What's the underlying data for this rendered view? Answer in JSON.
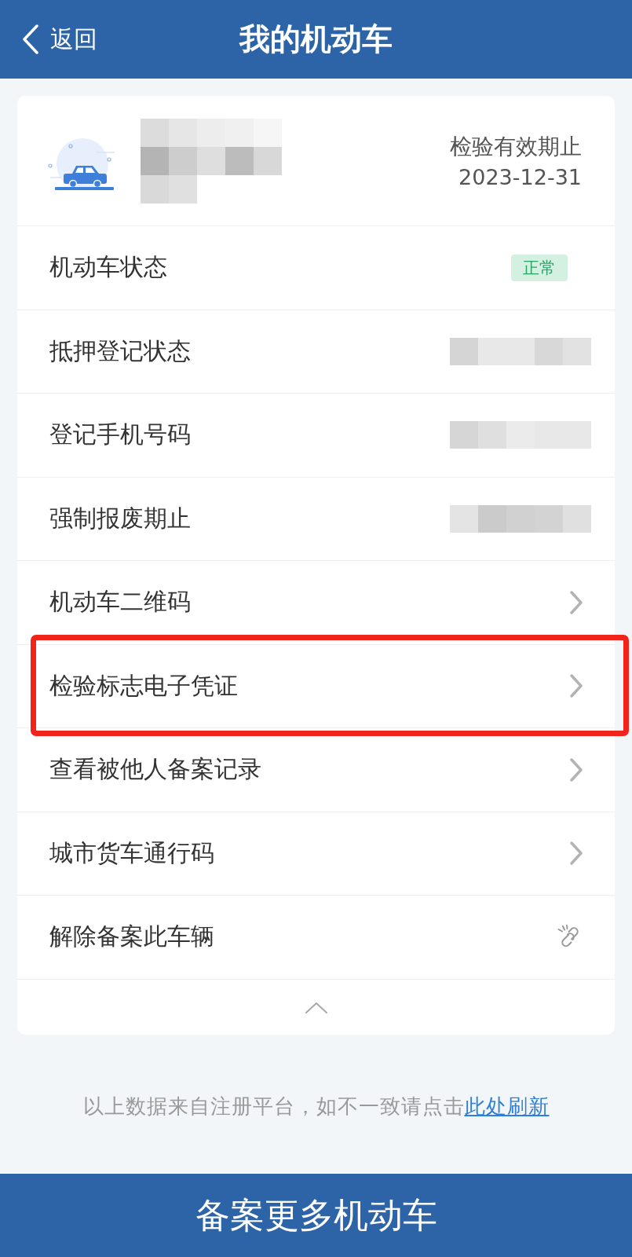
{
  "header": {
    "back_label": "返回",
    "title": "我的机动车"
  },
  "vehicle": {
    "inspection_label": "检验有效期止",
    "inspection_date": "2023-12-31"
  },
  "rows": [
    {
      "label": "机动车状态",
      "kind": "badge",
      "value": "正常",
      "highlighted": false
    },
    {
      "label": "抵押登记状态",
      "kind": "redacted",
      "highlighted": false
    },
    {
      "label": "登记手机号码",
      "kind": "redacted",
      "highlighted": false
    },
    {
      "label": "强制报废期止",
      "kind": "redacted",
      "highlighted": false
    },
    {
      "label": "机动车二维码",
      "kind": "link",
      "highlighted": false
    },
    {
      "label": "检验标志电子凭证",
      "kind": "link",
      "highlighted": true
    },
    {
      "label": "查看被他人备案记录",
      "kind": "link",
      "highlighted": false
    },
    {
      "label": "城市货车通行码",
      "kind": "link",
      "highlighted": false
    },
    {
      "label": "解除备案此车辆",
      "kind": "unlink",
      "highlighted": false
    }
  ],
  "footer_note": {
    "text": "以上数据来自注册平台，如不一致请点击",
    "link": "此处刷新"
  },
  "bottom_button": "备案更多机动车"
}
